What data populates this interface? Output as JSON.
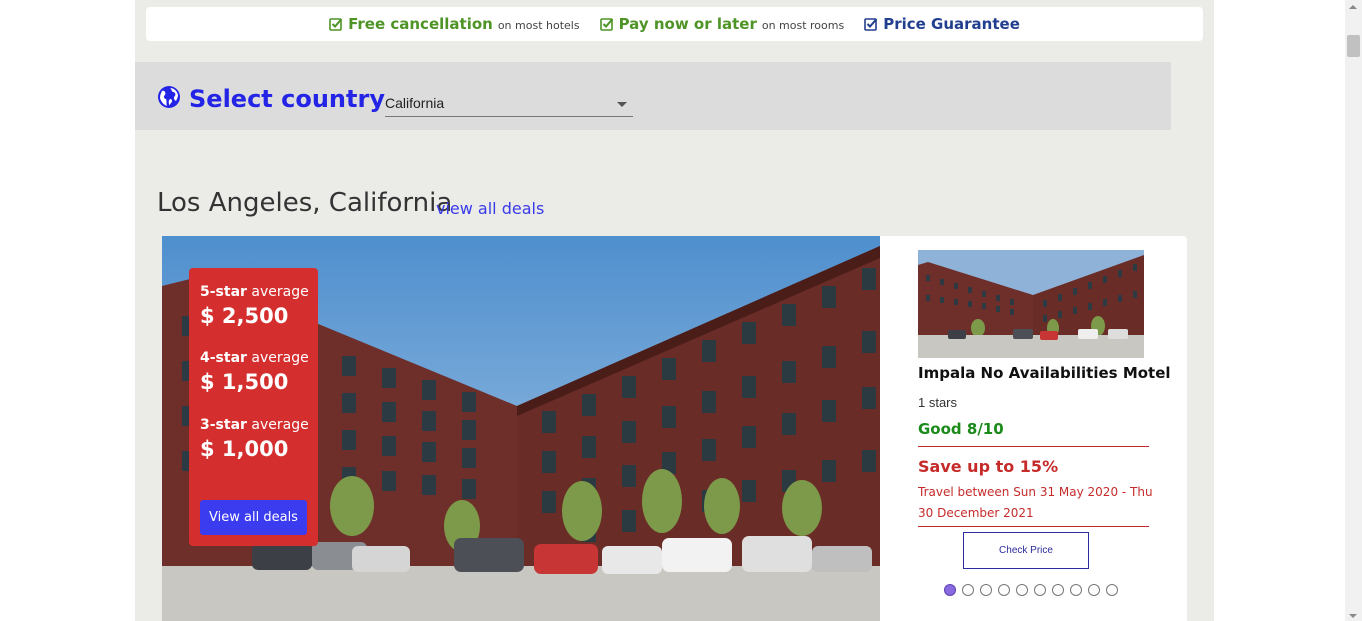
{
  "benefits": [
    {
      "main": "Free cancellation",
      "sub": "on most hotels",
      "color": "#4e9426"
    },
    {
      "main": "Pay now or later",
      "sub": "on most rooms",
      "color": "#4e9426"
    },
    {
      "main": "Price Guarantee",
      "sub": "",
      "color": "#223f8f"
    }
  ],
  "country": {
    "title": "Select country",
    "selected": "California",
    "icon": "globe-icon"
  },
  "city": {
    "title": "Los Angeles, California",
    "view_all_link": "view all deals"
  },
  "averages": [
    {
      "stars": "5-star",
      "label": "average",
      "price": "$ 2,500"
    },
    {
      "stars": "4-star",
      "label": "average",
      "price": "$ 1,500"
    },
    {
      "stars": "3-star",
      "label": "average",
      "price": "$ 1,000"
    }
  ],
  "view_all_button": "View all deals",
  "hotel": {
    "name": "Impala No Availabilities Motel",
    "stars": "1 stars",
    "rating": "Good 8/10",
    "save": "Save up to 15%",
    "travel": "Travel between Sun 31 May 2020 - Thu 30 December 2021",
    "check_price": "Check Price"
  },
  "carousel": {
    "count": 10,
    "active_index": 0
  },
  "colors": {
    "accent": "#3b3bef",
    "promo_red": "#d42e2e",
    "rating_green": "#1b8a1b"
  }
}
